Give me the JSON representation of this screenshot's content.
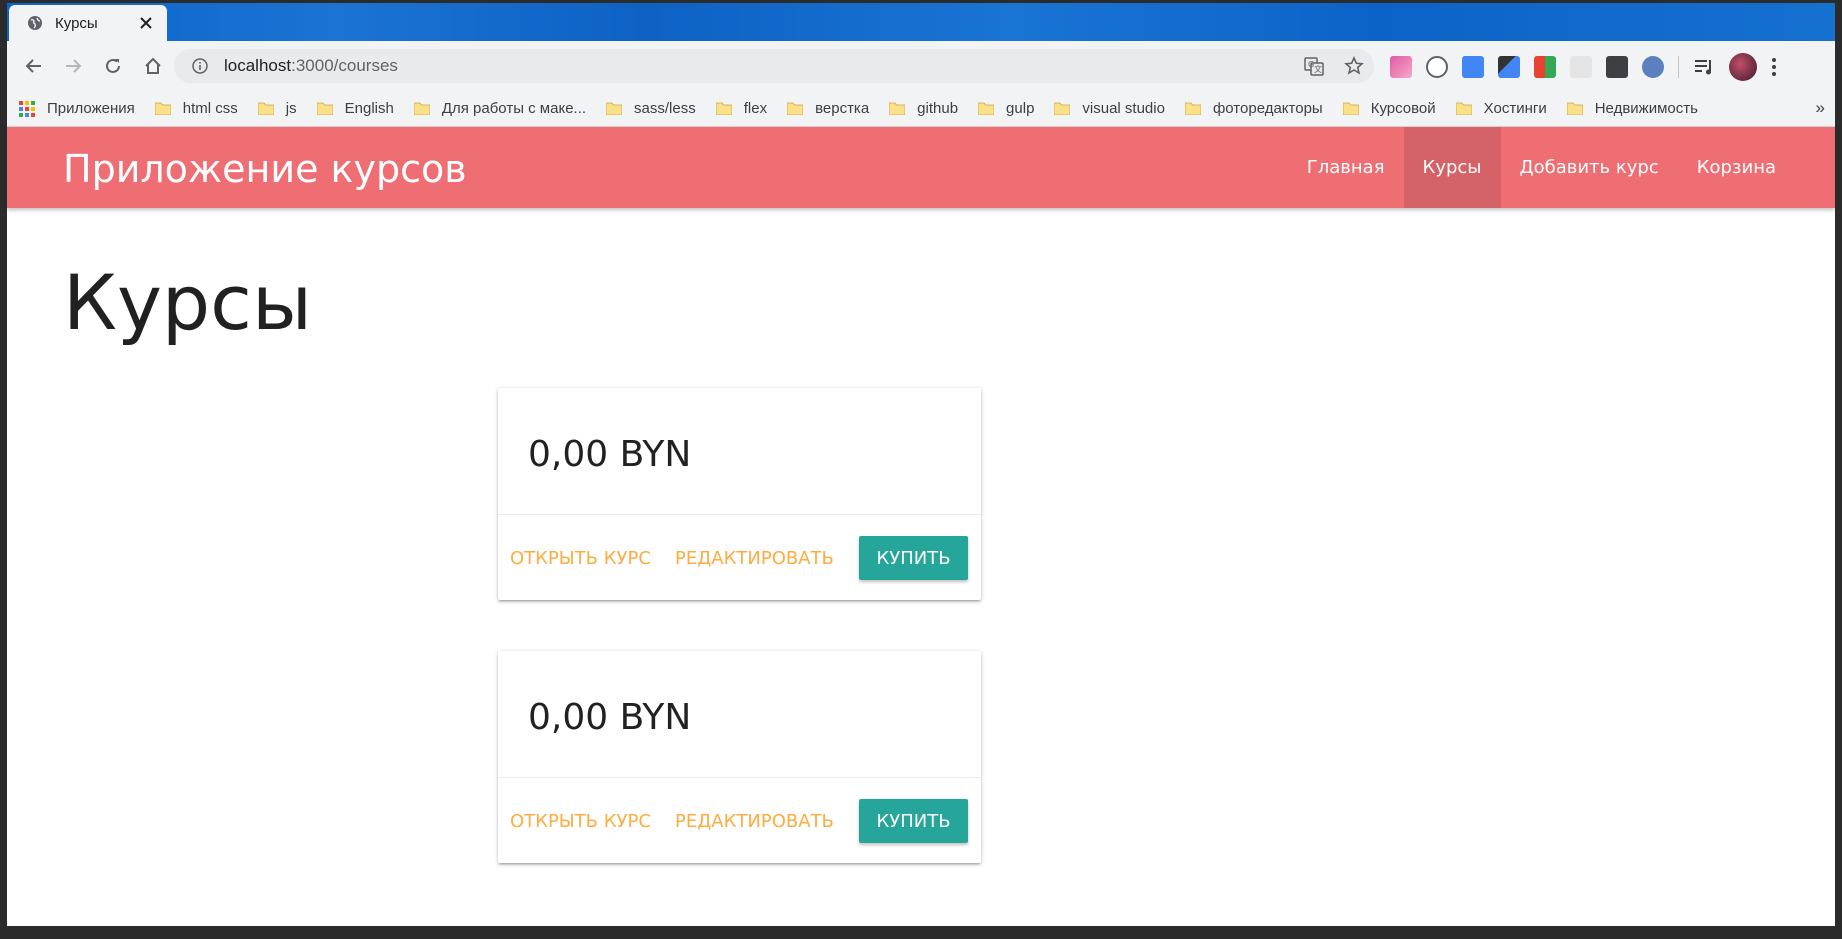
{
  "browser": {
    "tab_title": "Курсы",
    "url_host": "localhost",
    "url_path": ":3000/courses",
    "bookmarks": [
      {
        "label": "Приложения",
        "type": "apps"
      },
      {
        "label": "html css"
      },
      {
        "label": "js"
      },
      {
        "label": "English"
      },
      {
        "label": "Для работы с маке..."
      },
      {
        "label": "sass/less"
      },
      {
        "label": "flex"
      },
      {
        "label": "верстка"
      },
      {
        "label": "github"
      },
      {
        "label": "gulp"
      },
      {
        "label": "visual studio"
      },
      {
        "label": "фоторедакторы"
      },
      {
        "label": "Курсовой"
      },
      {
        "label": "Хостинги"
      },
      {
        "label": "Недвижимость"
      }
    ],
    "bookmarks_more": "»"
  },
  "app": {
    "brand": "Приложение курсов",
    "nav": [
      {
        "label": "Главная",
        "active": false
      },
      {
        "label": "Курсы",
        "active": true
      },
      {
        "label": "Добавить курс",
        "active": false
      },
      {
        "label": "Корзина",
        "active": false
      }
    ],
    "colors": {
      "nav_bg": "#ee6e73",
      "action_link": "#ffab40",
      "buy_button": "#26a69a"
    }
  },
  "page": {
    "title": "Курсы",
    "courses": [
      {
        "price": "0,00 BYN",
        "open_label": "Открыть курс",
        "edit_label": "Редактировать",
        "buy_label": "Купить"
      },
      {
        "price": "0,00 BYN",
        "open_label": "Открыть курс",
        "edit_label": "Редактировать",
        "buy_label": "Купить"
      }
    ]
  }
}
